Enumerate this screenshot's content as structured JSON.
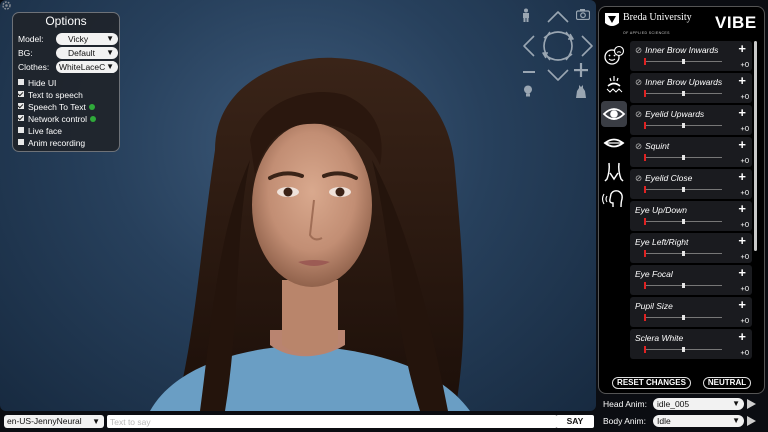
{
  "options": {
    "title": "Options",
    "model_label": "Model:",
    "model_value": "Vicky",
    "bg_label": "BG:",
    "bg_value": "Default",
    "clothes_label": "Clothes:",
    "clothes_value": "WhiteLaceC",
    "checks": [
      {
        "label": "Hide UI",
        "checked": false
      },
      {
        "label": "Text to speech",
        "checked": true
      },
      {
        "label": "Speech To Text",
        "checked": true
      },
      {
        "label": "Network control",
        "checked": true
      },
      {
        "label": "Live face",
        "checked": false
      },
      {
        "label": "Anim recording",
        "checked": false
      }
    ]
  },
  "brand": {
    "university": "Breda University",
    "university_sub": "OF APPLIED SCIENCES",
    "app_logo": "VIBE"
  },
  "blendshapes": [
    {
      "name": "Inner Brow Inwards",
      "value": "+0",
      "linked": true,
      "knob": 0.5
    },
    {
      "name": "Inner Brow Upwards",
      "value": "+0",
      "linked": true,
      "knob": 0.5
    },
    {
      "name": "Eyelid Upwards",
      "value": "+0",
      "linked": true,
      "knob": 0.5
    },
    {
      "name": "Squint",
      "value": "+0",
      "linked": true,
      "knob": 0.5
    },
    {
      "name": "Eyelid Close",
      "value": "+0",
      "linked": true,
      "knob": 0.5
    },
    {
      "name": "Eye Up/Down",
      "value": "+0",
      "linked": false,
      "knob": 0.5
    },
    {
      "name": "Eye Left/Right",
      "value": "+0",
      "linked": false,
      "knob": 0.5
    },
    {
      "name": "Eye Focal",
      "value": "+0",
      "linked": false,
      "knob": 0.5
    },
    {
      "name": "Pupil Size",
      "value": "+0",
      "linked": false,
      "knob": 0.5
    },
    {
      "name": "Sclera White",
      "value": "+0",
      "linked": false,
      "knob": 0.5
    }
  ],
  "panel_buttons": {
    "reset": "RESET CHANGES",
    "neutral": "NEUTRAL"
  },
  "bottom": {
    "voice": "en-US-JennyNeural",
    "say_placeholder": "Text to say",
    "say_label": "SAY"
  },
  "anim": {
    "head_label": "Head Anim:",
    "head_value": "idle_005",
    "body_label": "Body Anim:",
    "body_value": "Idle"
  },
  "colors": {
    "accent_red": "#e02222",
    "mic_green": "#2faa3a",
    "panel_bg": "#000000"
  },
  "icons": [
    "gear-icon",
    "person-icon",
    "camera-icon",
    "orbit-arrows-icon",
    "zoom-minus-icon",
    "zoom-plus-icon",
    "light-bulb-icon",
    "dress-icon",
    "face-expression-icon",
    "brow-icon",
    "eye-icon",
    "mouth-icon",
    "neck-icon",
    "speaking-head-icon",
    "link-icon",
    "plus-icon",
    "play-icon",
    "dropdown-arrow-icon"
  ]
}
